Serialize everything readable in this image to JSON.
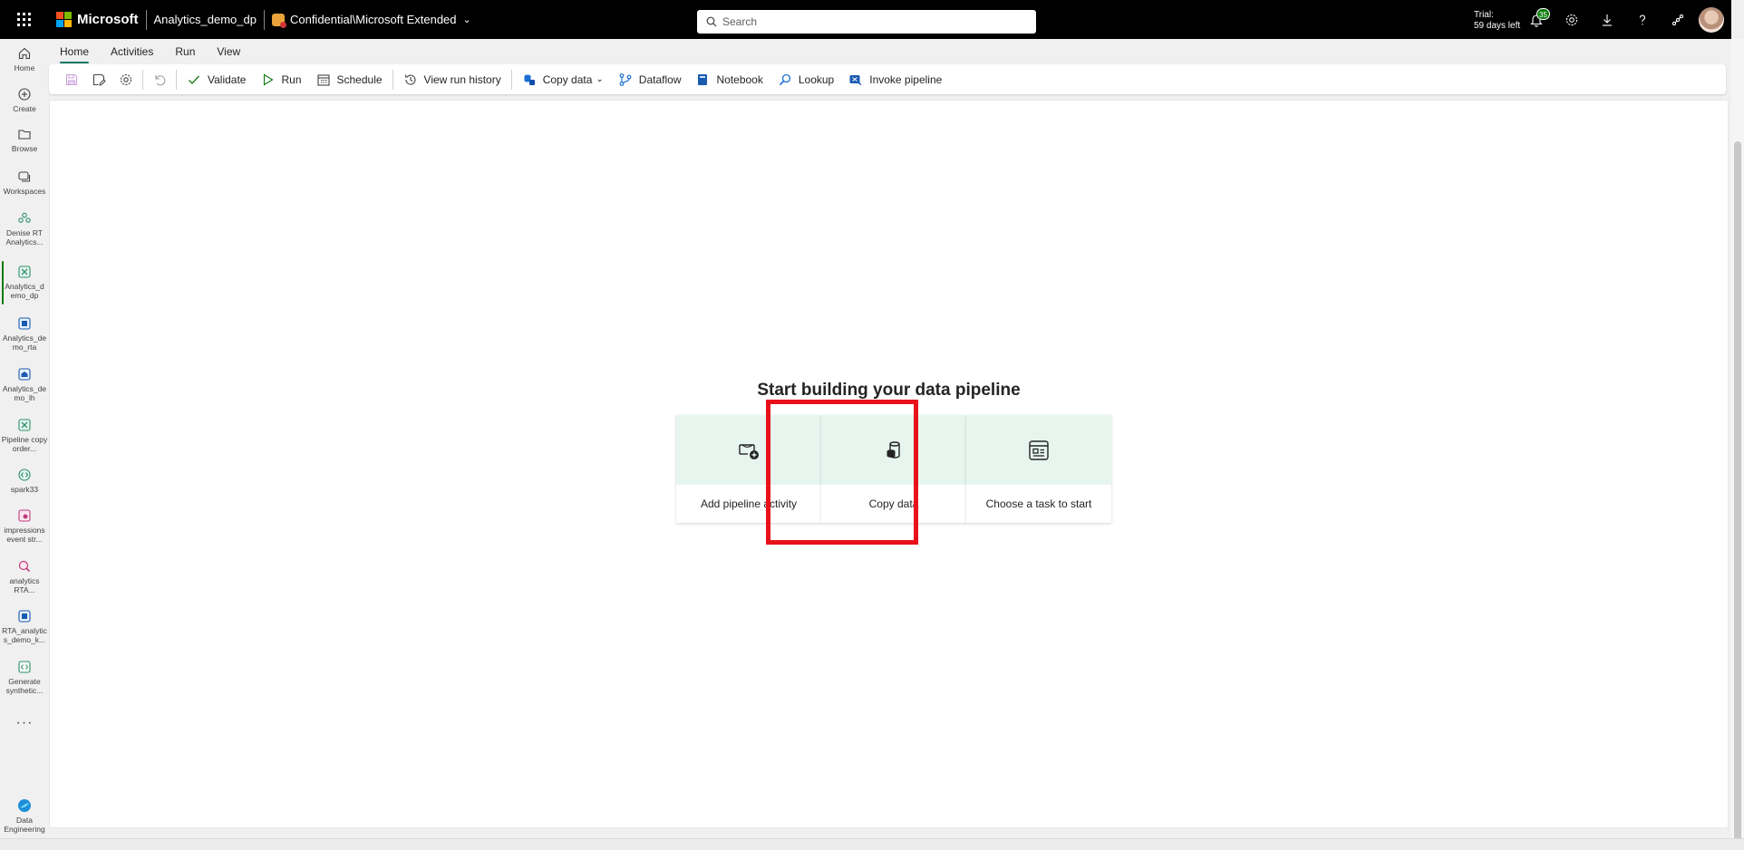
{
  "topbar": {
    "brand": "Microsoft",
    "workspace": "Analytics_demo_dp",
    "sensitivity": "Confidential\\Microsoft Extended",
    "search_placeholder": "Search",
    "trial_line1": "Trial:",
    "trial_line2": "59 days left",
    "notification_count": "35",
    "brand_colors": [
      "#f25022",
      "#7fba00",
      "#00a4ef",
      "#ffb900"
    ]
  },
  "rail": [
    {
      "label": "Home",
      "icon": "home-icon"
    },
    {
      "label": "Create",
      "icon": "create-icon"
    },
    {
      "label": "Browse",
      "icon": "browse-icon"
    },
    {
      "label": "Workspaces",
      "icon": "workspaces-icon"
    },
    {
      "label": "Denise RT Analytics...",
      "icon": "workspace-group-icon"
    },
    {
      "label": "Analytics_d emo_dp",
      "icon": "pipeline-icon",
      "active": true
    },
    {
      "label": "Analytics_de mo_rta",
      "icon": "kql-database-icon"
    },
    {
      "label": "Analytics_de mo_lh",
      "icon": "lakehouse-icon"
    },
    {
      "label": "Pipeline copy order...",
      "icon": "pipeline-icon"
    },
    {
      "label": "spark33",
      "icon": "environment-icon"
    },
    {
      "label": "impressions event str...",
      "icon": "eventstream-icon"
    },
    {
      "label": "analytics RTA...",
      "icon": "kql-queryset-icon"
    },
    {
      "label": "RTA_analytic s_demo_k...",
      "icon": "kql-database-icon"
    },
    {
      "label": "Generate synthetic...",
      "icon": "notebook-code-icon"
    },
    {
      "label": "Data Engineering",
      "icon": "data-engineering-icon"
    }
  ],
  "ribbon": {
    "tabs": [
      "Home",
      "Activities",
      "Run",
      "View"
    ],
    "active_tab": "Home",
    "buttons": {
      "validate": "Validate",
      "run": "Run",
      "schedule": "Schedule",
      "view_run_history": "View run history",
      "copy_data": "Copy data",
      "dataflow": "Dataflow",
      "notebook": "Notebook",
      "lookup": "Lookup",
      "invoke_pipeline": "Invoke pipeline"
    }
  },
  "canvas": {
    "title": "Start building your data pipeline",
    "cards": [
      {
        "label": "Add pipeline activity",
        "icon": "pipeline-add-icon"
      },
      {
        "label": "Copy data",
        "icon": "copy-data-icon"
      },
      {
        "label": "Choose a task to start",
        "icon": "task-template-icon"
      }
    ],
    "highlight_color": "#e8111b",
    "card_accent": "#e6f6ef"
  }
}
